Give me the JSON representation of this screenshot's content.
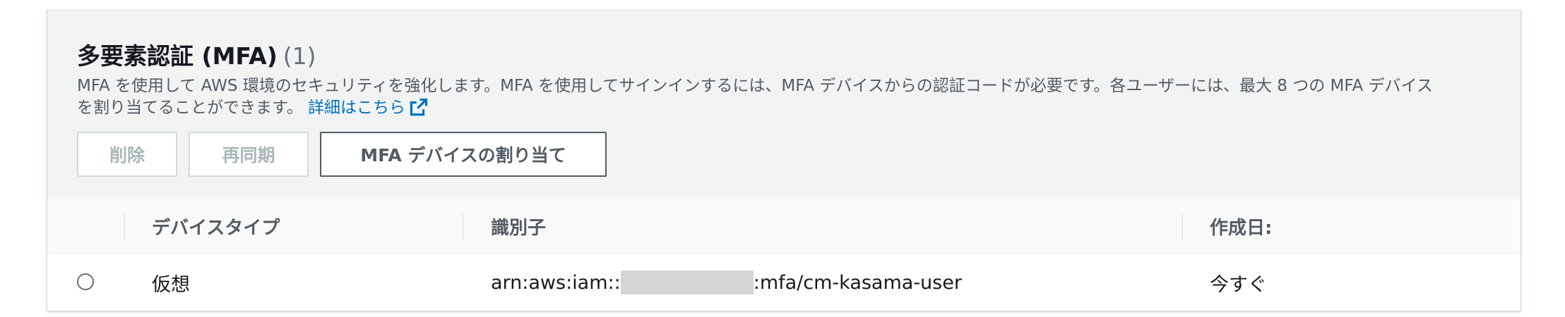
{
  "section": {
    "title": "多要素認証 (MFA)",
    "count": "(1)",
    "description_line1": "MFA を使用して AWS 環境のセキュリティを強化します。MFA を使用してサインインするには、MFA デバイスからの認証コードが必要です。各ユーザーには、最大 8 つの MFA デバイス",
    "description_line2": "を割り当てることができます。",
    "details_link": "詳細はこちら",
    "details_icon": "external-link-icon"
  },
  "actions": {
    "delete_label": "削除",
    "resync_label": "再同期",
    "assign_label": "MFA デバイスの割り当て"
  },
  "table": {
    "columns": [
      "デバイスタイプ",
      "識別子",
      "作成日:"
    ],
    "rows": [
      {
        "device_type": "仮想",
        "identifier_prefix": "arn:aws:iam::",
        "identifier_suffix": ":mfa/cm-kasama-user",
        "created": "今すぐ",
        "selected": false
      }
    ]
  },
  "colors": {
    "link": "#0073bb",
    "header_bg": "#f2f3f3",
    "border": "#d5dbdb"
  }
}
